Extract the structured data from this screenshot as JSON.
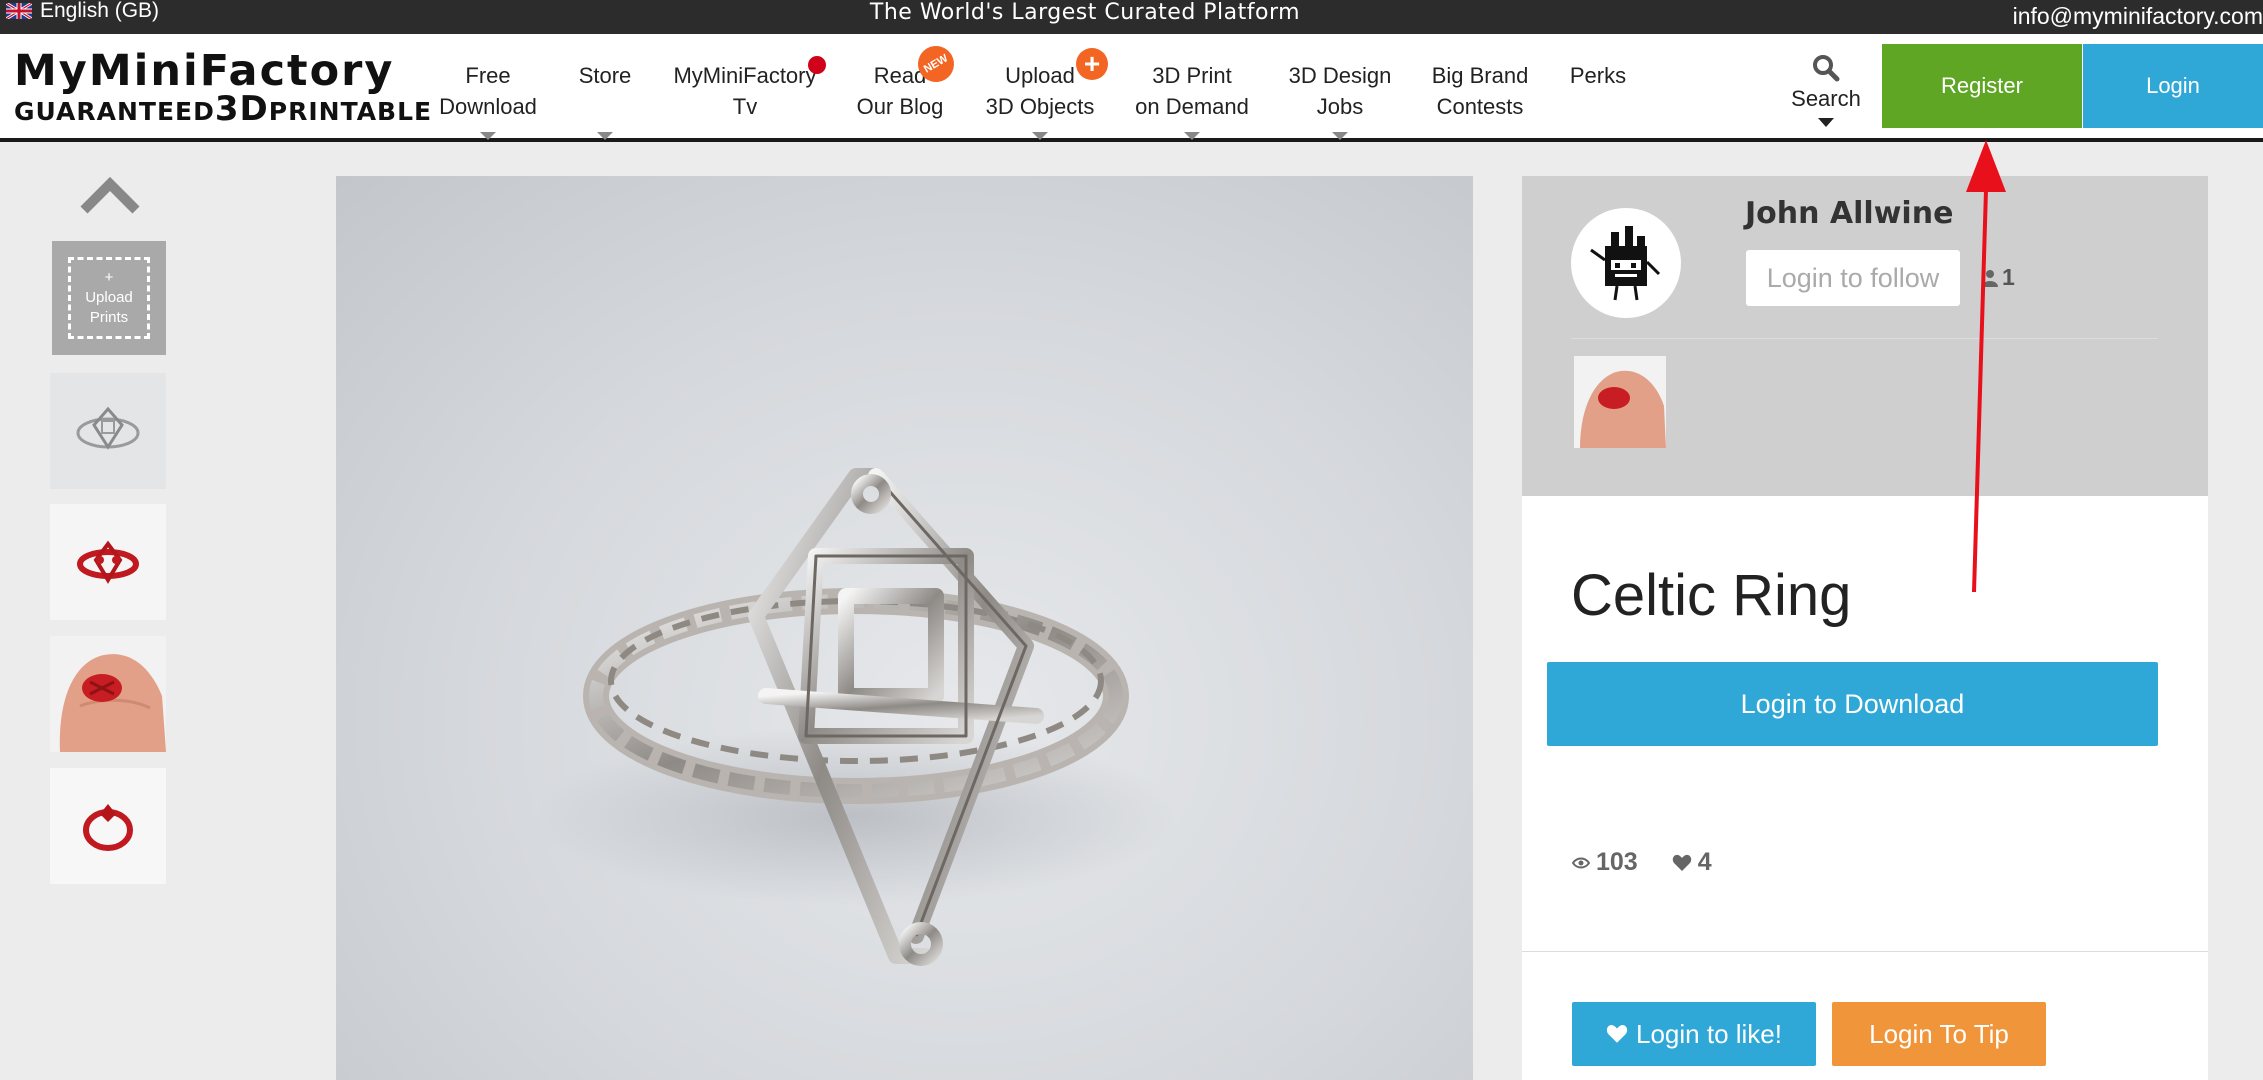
{
  "topbar": {
    "language": "English (GB)",
    "tagline": "The World's Largest Curated Platform",
    "email": "info@myminifactory.com"
  },
  "logo": {
    "line1": "MyMiniFactory",
    "line2_prefix": "GUARANTEED",
    "line2_bold": "3D",
    "line2_suffix": "PRINTABLE"
  },
  "nav": {
    "items": [
      {
        "line1": "Free",
        "line2": "Download"
      },
      {
        "line1": "Store",
        "line2": ""
      },
      {
        "line1": "MyMiniFactory",
        "line2": "Tv"
      },
      {
        "line1": "Read",
        "line2": "Our Blog",
        "badge": "NEW"
      },
      {
        "line1": "Upload",
        "line2": "3D Objects",
        "badge": "+"
      },
      {
        "line1": "3D Print",
        "line2": "on Demand"
      },
      {
        "line1": "3D Design",
        "line2": "Jobs"
      },
      {
        "line1": "Big Brand",
        "line2": "Contests"
      },
      {
        "line1": "Perks",
        "line2": ""
      }
    ],
    "search_label": "Search",
    "register_label": "Register",
    "login_label": "Login"
  },
  "thumbnails": {
    "upload_plus": "+",
    "upload_line1": "Upload",
    "upload_line2": "Prints"
  },
  "designer": {
    "name": "John Allwine",
    "follow_label": "Login to follow",
    "followers": "1"
  },
  "object": {
    "title": "Celtic Ring",
    "download_label": "Login to Download",
    "views": "103",
    "likes": "4",
    "like_label": "Login to like!",
    "tip_label": "Login To Tip"
  },
  "colors": {
    "register": "#5ea624",
    "primary": "#2fa8d8",
    "tip": "#f0953a",
    "annotation_arrow": "#e8101a"
  }
}
